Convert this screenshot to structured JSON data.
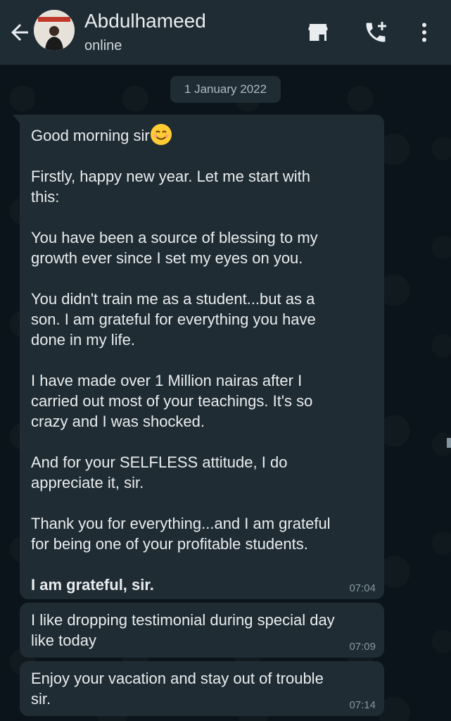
{
  "contact": {
    "name": "Abdulhameed",
    "status": "online"
  },
  "header_icons": {
    "back": "arrow-left-icon",
    "store": "store-icon",
    "call": "add-call-icon",
    "menu": "more-vert-icon"
  },
  "date_label": "1 January 2022",
  "messages": [
    {
      "greeting": "Good morning sir",
      "emoji": "smiling-face-emoji",
      "body": "Firstly, happy new year. Let me start with\nthis:\n\nYou have been a source of blessing to my\ngrowth ever since I set my eyes on you.\n\nYou didn't train me as a student...but as a\nson. I am grateful for everything you have\ndone in my life.\n\nI have made over 1 Million nairas after I\ncarried out most of your teachings. It's so\ncrazy and I was shocked.\n\nAnd for your SELFLESS attitude, I do\nappreciate it, sir.\n\nThank you for everything...and I am grateful\nfor being one of your profitable students.",
      "closing": "I am grateful, sir.",
      "time": "07:04"
    },
    {
      "text": "I like dropping testimonial during special day\nlike today",
      "time": "07:09"
    },
    {
      "text": "Enjoy your vacation and stay out of trouble\nsir.",
      "time": "07:14"
    }
  ],
  "colors": {
    "header": "#1f2c33",
    "background": "#0b141a",
    "bubble": "#1f2c33",
    "text": "#e9edef",
    "meta": "#8696a0"
  }
}
